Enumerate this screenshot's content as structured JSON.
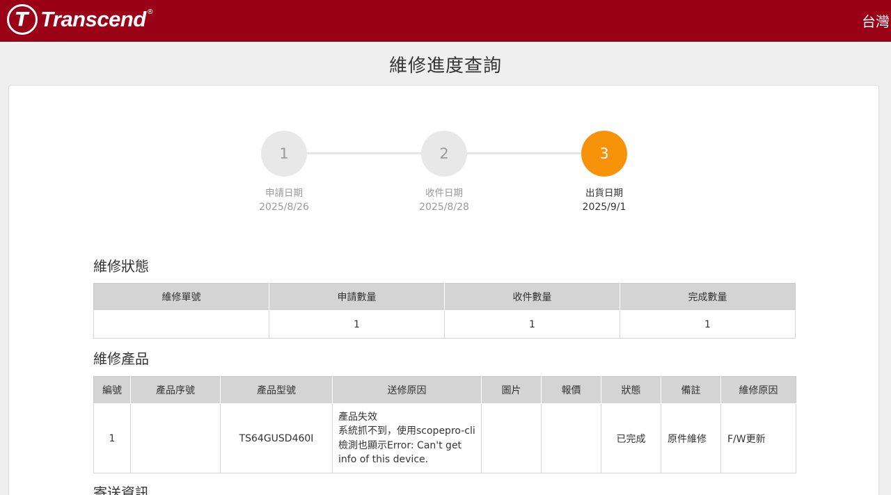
{
  "header": {
    "brand_mark": "T",
    "brand_name": "Transcend",
    "brand_reg": "®",
    "region": "台灣"
  },
  "page": {
    "title": "維修進度查詢"
  },
  "colors": {
    "brand_red": "#9a0016",
    "active_step": "#f7930a",
    "inactive_step": "#e8e8e8",
    "table_header": "#d4d4d4"
  },
  "steps": [
    {
      "number": "1",
      "label": "申請日期",
      "date": "2025/8/26",
      "active": false
    },
    {
      "number": "2",
      "label": "收件日期",
      "date": "2025/8/28",
      "active": false
    },
    {
      "number": "3",
      "label": "出貨日期",
      "date": "2025/9/1",
      "active": true
    }
  ],
  "status_section": {
    "title": "維修狀態",
    "columns": [
      "維修單號",
      "申請數量",
      "收件數量",
      "完成數量"
    ],
    "row": [
      "",
      "1",
      "1",
      "1"
    ]
  },
  "product_section": {
    "title": "維修產品",
    "columns": [
      "編號",
      "產品序號",
      "產品型號",
      "送修原因",
      "圖片",
      "報價",
      "狀態",
      "備註",
      "維修原因"
    ],
    "row": {
      "no": "1",
      "serial": "",
      "model": "TS64GUSD460I",
      "reason_lines": [
        "產品失效",
        "系統抓不到，使用scopepro-cli",
        "檢測也顯示Error: Can't get",
        "info of this device."
      ],
      "image": "",
      "quote": "",
      "status": "已完成",
      "note": "原件維修",
      "repair_reason": "F/W更新"
    }
  },
  "shipping_section": {
    "title": "寄送資訊"
  }
}
